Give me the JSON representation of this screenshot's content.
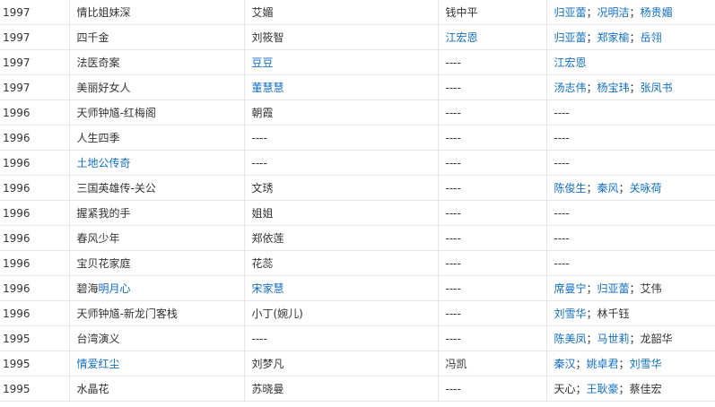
{
  "rows": [
    {
      "year": "1997",
      "title": [
        {
          "t": "情比姐妹深",
          "link": false
        }
      ],
      "role": [
        {
          "t": "艾媚",
          "link": false
        }
      ],
      "director": [
        {
          "t": "钱中平",
          "link": false
        }
      ],
      "costars": [
        {
          "t": "归亚蕾",
          "link": true
        },
        {
          "t": "况明洁",
          "link": true
        },
        {
          "t": "杨贵媚",
          "link": true
        }
      ]
    },
    {
      "year": "1997",
      "title": [
        {
          "t": "四千金",
          "link": false
        }
      ],
      "role": [
        {
          "t": "刘筱智",
          "link": false
        }
      ],
      "director": [
        {
          "t": "江宏恩",
          "link": true
        }
      ],
      "costars": [
        {
          "t": "归亚蕾",
          "link": true
        },
        {
          "t": "郑家榆",
          "link": true
        },
        {
          "t": "岳翎",
          "link": true
        }
      ]
    },
    {
      "year": "1997",
      "title": [
        {
          "t": "法医奇案",
          "link": false
        }
      ],
      "role": [
        {
          "t": "豆豆",
          "link": true
        }
      ],
      "director": [
        {
          "t": "----",
          "link": false
        }
      ],
      "costars": [
        {
          "t": "江宏恩",
          "link": true
        }
      ]
    },
    {
      "year": "1997",
      "title": [
        {
          "t": "美丽好女人",
          "link": false
        }
      ],
      "role": [
        {
          "t": "董慧慧",
          "link": true
        }
      ],
      "director": [
        {
          "t": "----",
          "link": false
        }
      ],
      "costars": [
        {
          "t": "汤志伟",
          "link": true
        },
        {
          "t": "杨宝玮",
          "link": true
        },
        {
          "t": "张凤书",
          "link": true
        }
      ]
    },
    {
      "year": "1996",
      "title": [
        {
          "t": "天师钟馗-红梅阁",
          "link": false
        }
      ],
      "role": [
        {
          "t": "朝霞",
          "link": false
        }
      ],
      "director": [
        {
          "t": "----",
          "link": false
        }
      ],
      "costars": [
        {
          "t": "----",
          "link": false
        }
      ]
    },
    {
      "year": "1996",
      "title": [
        {
          "t": "人生四季",
          "link": false
        }
      ],
      "role": [
        {
          "t": "----",
          "link": false
        }
      ],
      "director": [
        {
          "t": "----",
          "link": false
        }
      ],
      "costars": [
        {
          "t": "----",
          "link": false
        }
      ]
    },
    {
      "year": "1996",
      "title": [
        {
          "t": "土地公传奇",
          "link": true
        }
      ],
      "role": [
        {
          "t": "----",
          "link": false
        }
      ],
      "director": [
        {
          "t": "----",
          "link": false
        }
      ],
      "costars": [
        {
          "t": "----",
          "link": false
        }
      ]
    },
    {
      "year": "1996",
      "title": [
        {
          "t": "三国英雄传-关公",
          "link": false
        }
      ],
      "role": [
        {
          "t": "文琇",
          "link": false
        }
      ],
      "director": [
        {
          "t": "----",
          "link": false
        }
      ],
      "costars": [
        {
          "t": "陈俊生",
          "link": true
        },
        {
          "t": "秦风",
          "link": true
        },
        {
          "t": "关咏荷",
          "link": true
        }
      ]
    },
    {
      "year": "1996",
      "title": [
        {
          "t": "握紧我的手",
          "link": false
        }
      ],
      "role": [
        {
          "t": "姐姐",
          "link": false
        }
      ],
      "director": [
        {
          "t": "----",
          "link": false
        }
      ],
      "costars": [
        {
          "t": "----",
          "link": false
        }
      ]
    },
    {
      "year": "1996",
      "title": [
        {
          "t": "春风少年",
          "link": false
        }
      ],
      "role": [
        {
          "t": "郑依莲",
          "link": false
        }
      ],
      "director": [
        {
          "t": "----",
          "link": false
        }
      ],
      "costars": [
        {
          "t": "----",
          "link": false
        }
      ]
    },
    {
      "year": "1996",
      "title": [
        {
          "t": "宝贝花家庭",
          "link": false
        }
      ],
      "role": [
        {
          "t": "花蕊",
          "link": false
        }
      ],
      "director": [
        {
          "t": "----",
          "link": false
        }
      ],
      "costars": [
        {
          "t": "----",
          "link": false
        }
      ]
    },
    {
      "year": "1996",
      "title": [
        {
          "t": "碧海",
          "link": false
        },
        {
          "t": "明月心",
          "link": true
        }
      ],
      "role": [
        {
          "t": "宋家慧",
          "link": true
        }
      ],
      "director": [
        {
          "t": "----",
          "link": false
        }
      ],
      "costars": [
        {
          "t": "席曼宁",
          "link": true
        },
        {
          "t": "归亚蕾",
          "link": true
        },
        {
          "t": "艾伟",
          "link": false
        }
      ]
    },
    {
      "year": "1996",
      "title": [
        {
          "t": "天师钟馗-新龙门客栈",
          "link": false
        }
      ],
      "role": [
        {
          "t": "小丁(婉儿)",
          "link": false
        }
      ],
      "director": [
        {
          "t": "----",
          "link": false
        }
      ],
      "costars": [
        {
          "t": "刘雪华",
          "link": true
        },
        {
          "t": "林千钰",
          "link": false
        }
      ]
    },
    {
      "year": "1995",
      "title": [
        {
          "t": "台湾演义",
          "link": false
        }
      ],
      "role": [
        {
          "t": "----",
          "link": false
        }
      ],
      "director": [
        {
          "t": "----",
          "link": false
        }
      ],
      "costars": [
        {
          "t": "陈美凤",
          "link": true
        },
        {
          "t": "马世莉",
          "link": true
        },
        {
          "t": "龙韶华",
          "link": false
        }
      ]
    },
    {
      "year": "1995",
      "title": [
        {
          "t": "情爱红尘",
          "link": true
        }
      ],
      "role": [
        {
          "t": "刘梦凡",
          "link": false
        }
      ],
      "director": [
        {
          "t": "冯凯",
          "link": false
        }
      ],
      "costars": [
        {
          "t": "秦汉",
          "link": true
        },
        {
          "t": "姚卓君",
          "link": true
        },
        {
          "t": "刘雪华",
          "link": true
        }
      ]
    },
    {
      "year": "1995",
      "title": [
        {
          "t": "水晶花",
          "link": false
        }
      ],
      "role": [
        {
          "t": "苏晓曼",
          "link": false
        }
      ],
      "director": [
        {
          "t": "----",
          "link": false
        }
      ],
      "costars": [
        {
          "t": "天心",
          "link": false
        },
        {
          "t": "王耿豪",
          "link": true
        },
        {
          "t": "蔡佳宏",
          "link": false
        }
      ]
    }
  ],
  "separator": "；",
  "colors": {
    "text": "#333333",
    "link": "#136ec2",
    "border": "#e6e6e6"
  }
}
